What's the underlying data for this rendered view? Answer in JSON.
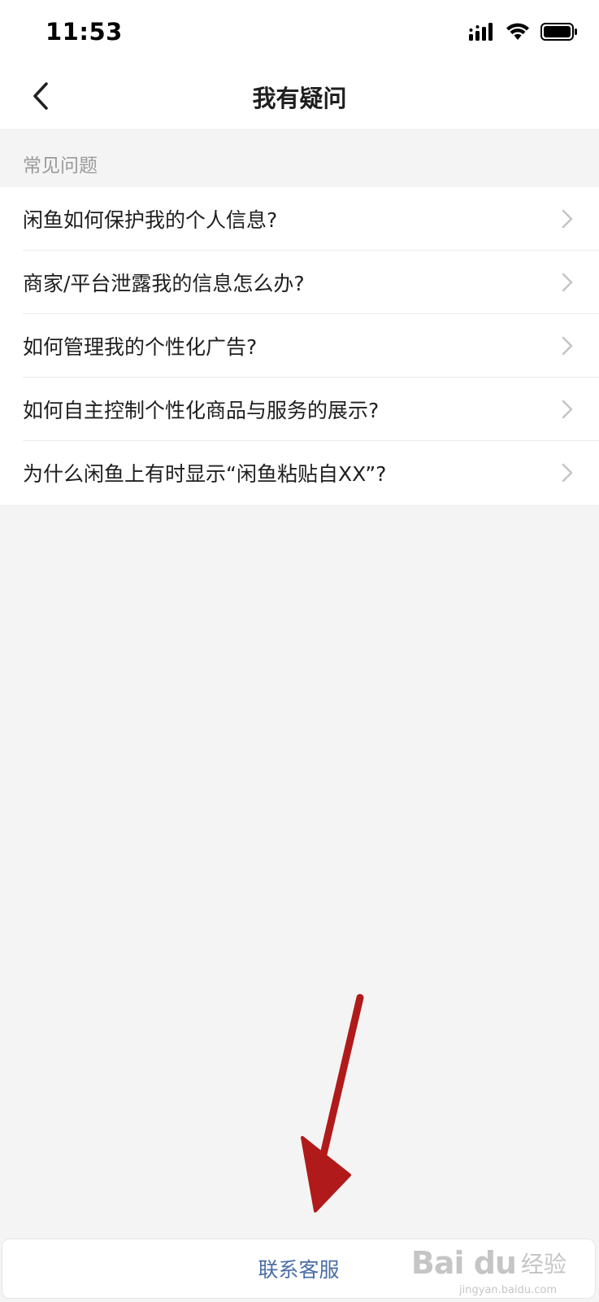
{
  "status_bar": {
    "time": "11:53"
  },
  "nav": {
    "title": "我有疑问",
    "back_icon": "chevron-left-icon"
  },
  "faq": {
    "section_label": "常见问题",
    "items": [
      {
        "label": "闲鱼如何保护我的个人信息?"
      },
      {
        "label": "商家/平台泄露我的信息怎么办?"
      },
      {
        "label": "如何管理我的个性化广告?"
      },
      {
        "label": "如何自主控制个性化商品与服务的展示?"
      },
      {
        "label": "为什么闲鱼上有时显示“闲鱼粘贴自XX”?"
      }
    ]
  },
  "footer": {
    "contact_label": "联系客服"
  },
  "watermark": {
    "logo": "Bai du",
    "text": "经验",
    "url": "jingyan.baidu.com"
  },
  "colors": {
    "accent": "#4a6da7",
    "arrow": "#b11a1a",
    "background": "#f4f4f4"
  }
}
